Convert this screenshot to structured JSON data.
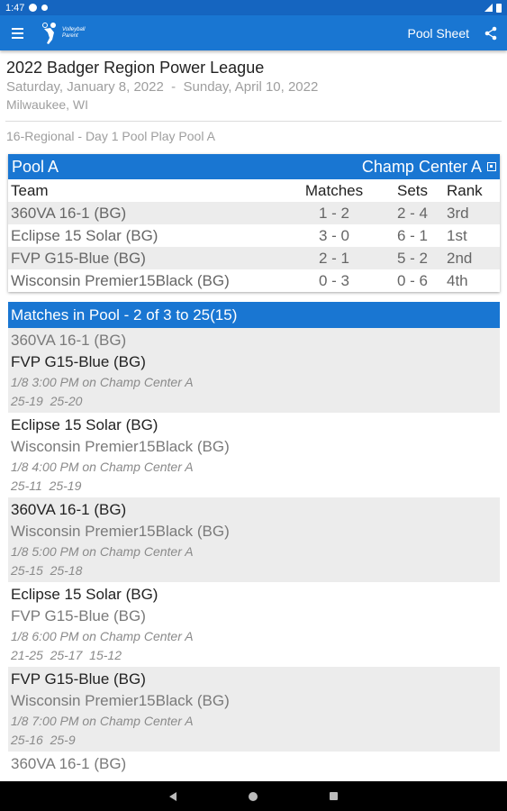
{
  "status_bar": {
    "time": "1:47"
  },
  "app_bar": {
    "title": "Pool Sheet",
    "logo_line1": "Volleyball",
    "logo_line2": "Parent"
  },
  "event": {
    "title": "2022 Badger Region Power League",
    "dates": "Saturday, January 8, 2022  -  Sunday, April 10, 2022",
    "location": "Milwaukee, WI",
    "division": "16-Regional - Day 1 Pool Play Pool A"
  },
  "pool": {
    "name": "Pool A",
    "court": "Champ Center A",
    "columns": {
      "team": "Team",
      "matches": "Matches",
      "sets": "Sets",
      "rank": "Rank"
    },
    "rows": [
      {
        "team": "360VA 16-1 (BG)",
        "matches": "1 - 2",
        "sets": "2 - 4",
        "rank": "3rd"
      },
      {
        "team": "Eclipse 15 Solar (BG)",
        "matches": "3 - 0",
        "sets": "6 - 1",
        "rank": "1st"
      },
      {
        "team": "FVP G15-Blue (BG)",
        "matches": "2 - 1",
        "sets": "5 - 2",
        "rank": "2nd"
      },
      {
        "team": "Wisconsin Premier15Black (BG)",
        "matches": "0 - 3",
        "sets": "0 - 6",
        "rank": "4th"
      }
    ]
  },
  "matches": {
    "header": "Matches in Pool - 2 of 3 to 25(15)",
    "items": [
      {
        "team1": "360VA 16-1 (BG)",
        "team2": "FVP G15-Blue (BG)",
        "info": "1/8 3:00 PM on Champ Center A",
        "scores": "25-19  25-20"
      },
      {
        "team1": "Eclipse 15 Solar (BG)",
        "team2": "Wisconsin Premier15Black (BG)",
        "info": "1/8 4:00 PM on Champ Center A",
        "scores": "25-11  25-19"
      },
      {
        "team1": "360VA 16-1 (BG)",
        "team2": "Wisconsin Premier15Black (BG)",
        "info": "1/8 5:00 PM on Champ Center A",
        "scores": "25-15  25-18"
      },
      {
        "team1": "Eclipse 15 Solar (BG)",
        "team2": "FVP G15-Blue (BG)",
        "info": "1/8 6:00 PM on Champ Center A",
        "scores": "21-25  25-17  15-12"
      },
      {
        "team1": "FVP G15-Blue (BG)",
        "team2": "Wisconsin Premier15Black (BG)",
        "info": "1/8 7:00 PM on Champ Center A",
        "scores": "25-16  25-9"
      },
      {
        "team1": "360VA 16-1 (BG)",
        "team2": "",
        "info": "",
        "scores": ""
      }
    ]
  },
  "colors": {
    "primary": "#1976d2",
    "status": "#1565c0",
    "shaded_row": "#ececec"
  }
}
